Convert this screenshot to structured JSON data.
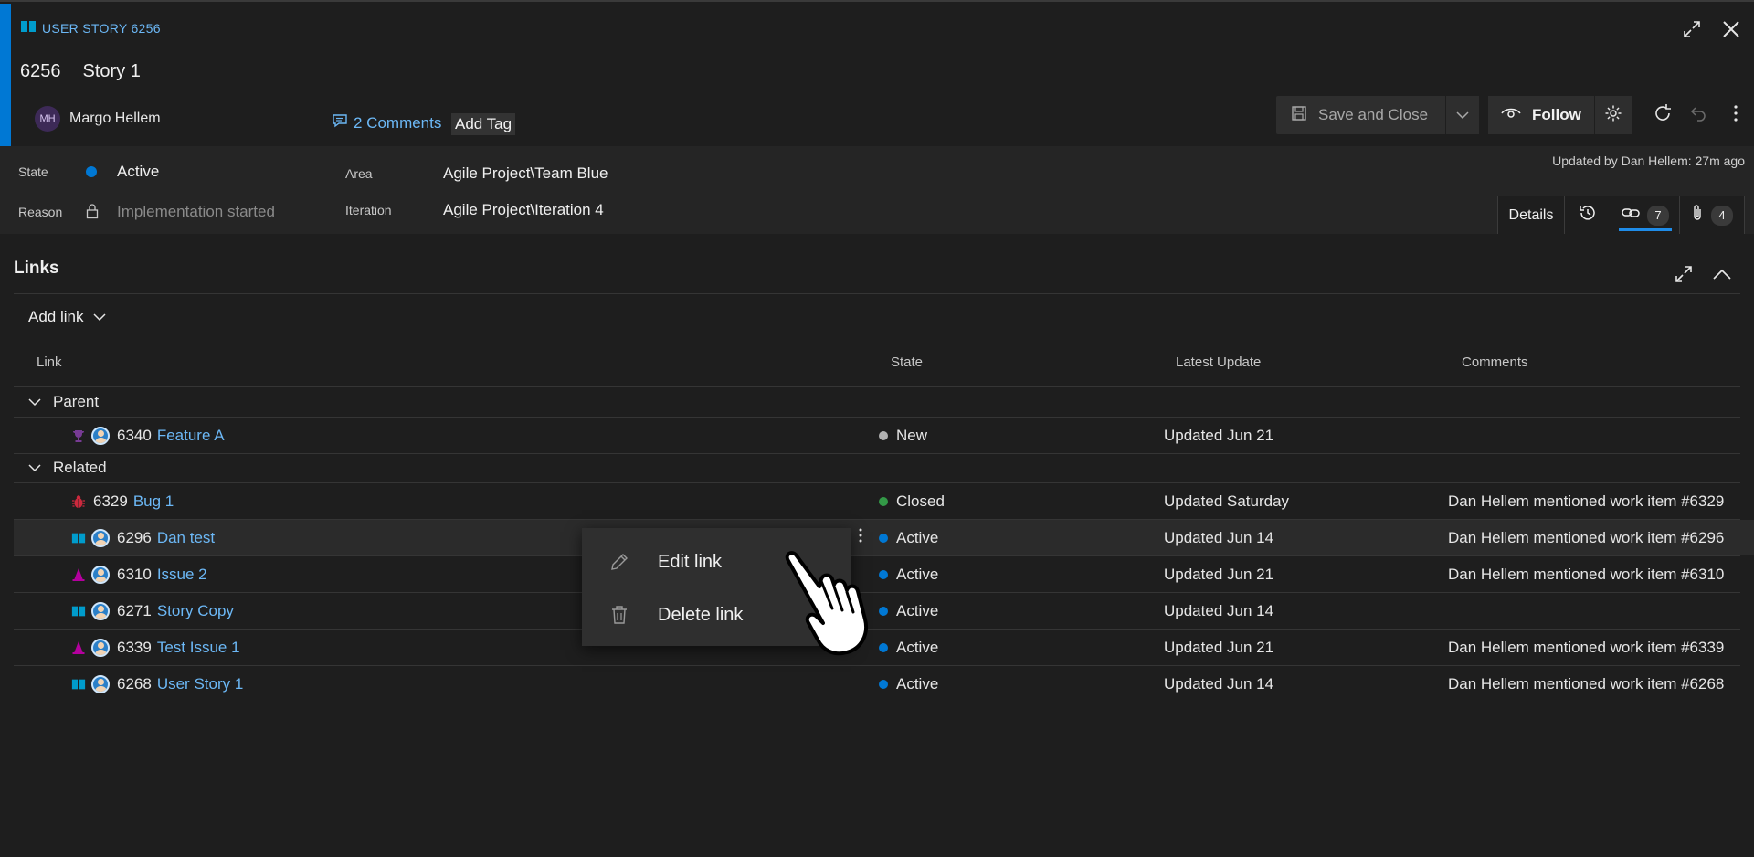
{
  "work_item": {
    "type_label": "USER STORY 6256",
    "id": "6256",
    "title": "Story 1",
    "assignee_initials": "MH",
    "assignee_name": "Margo Hellem",
    "comments_label": "2 Comments",
    "add_tag_label": "Add Tag"
  },
  "toolbar": {
    "save_label": "Save and Close",
    "follow_label": "Follow"
  },
  "fields": {
    "state_label": "State",
    "state_value": "Active",
    "reason_label": "Reason",
    "reason_value": "Implementation started",
    "area_label": "Area",
    "area_value": "Agile Project\\Team Blue",
    "iteration_label": "Iteration",
    "iteration_value": "Agile Project\\Iteration 4",
    "updated_by": "Updated by Dan Hellem: 27m ago"
  },
  "tabs": {
    "details_label": "Details",
    "links_count": "7",
    "attachments_count": "4"
  },
  "links": {
    "heading": "Links",
    "add_link_label": "Add link",
    "columns": {
      "link": "Link",
      "state": "State",
      "latest_update": "Latest Update",
      "comments": "Comments"
    },
    "groups": {
      "parent": {
        "label": "Parent",
        "rows": [
          {
            "icon": "trophy-icon",
            "id": "6340",
            "title": "Feature A",
            "state": "New",
            "state_color": "#b2b2b2",
            "updated": "Updated Jun 21",
            "comment": ""
          }
        ]
      },
      "related": {
        "label": "Related",
        "rows": [
          {
            "icon": "bug-icon",
            "id": "6329",
            "title": "Bug 1",
            "state": "Closed",
            "state_color": "#339947",
            "updated": "Updated Saturday",
            "comment": "Dan Hellem mentioned work item #6329"
          },
          {
            "icon": "book-icon",
            "id": "6296",
            "title": "Dan test",
            "state": "Active",
            "state_color": "#0078d4",
            "updated": "Updated Jun 14",
            "comment": "Dan Hellem mentioned work item #6296"
          },
          {
            "icon": "issue-icon",
            "id": "6310",
            "title": "Issue 2",
            "state": "Active",
            "state_color": "#0078d4",
            "updated": "Updated Jun 21",
            "comment": "Dan Hellem mentioned work item #6310"
          },
          {
            "icon": "book-icon",
            "id": "6271",
            "title": "Story Copy",
            "state": "Active",
            "state_color": "#0078d4",
            "updated": "Updated Jun 14",
            "comment": ""
          },
          {
            "icon": "issue-icon",
            "id": "6339",
            "title": "Test Issue 1",
            "state": "Active",
            "state_color": "#0078d4",
            "updated": "Updated Jun 21",
            "comment": "Dan Hellem mentioned work item #6339"
          },
          {
            "icon": "book-icon",
            "id": "6268",
            "title": "User Story 1",
            "state": "Active",
            "state_color": "#0078d4",
            "updated": "Updated Jun 14",
            "comment": "Dan Hellem mentioned work item #6268"
          }
        ]
      }
    }
  },
  "context_menu": {
    "edit_label": "Edit link",
    "delete_label": "Delete link"
  },
  "colors": {
    "accent": "#0078d4",
    "link": "#6cb8f6",
    "background": "#1e1e1e"
  }
}
